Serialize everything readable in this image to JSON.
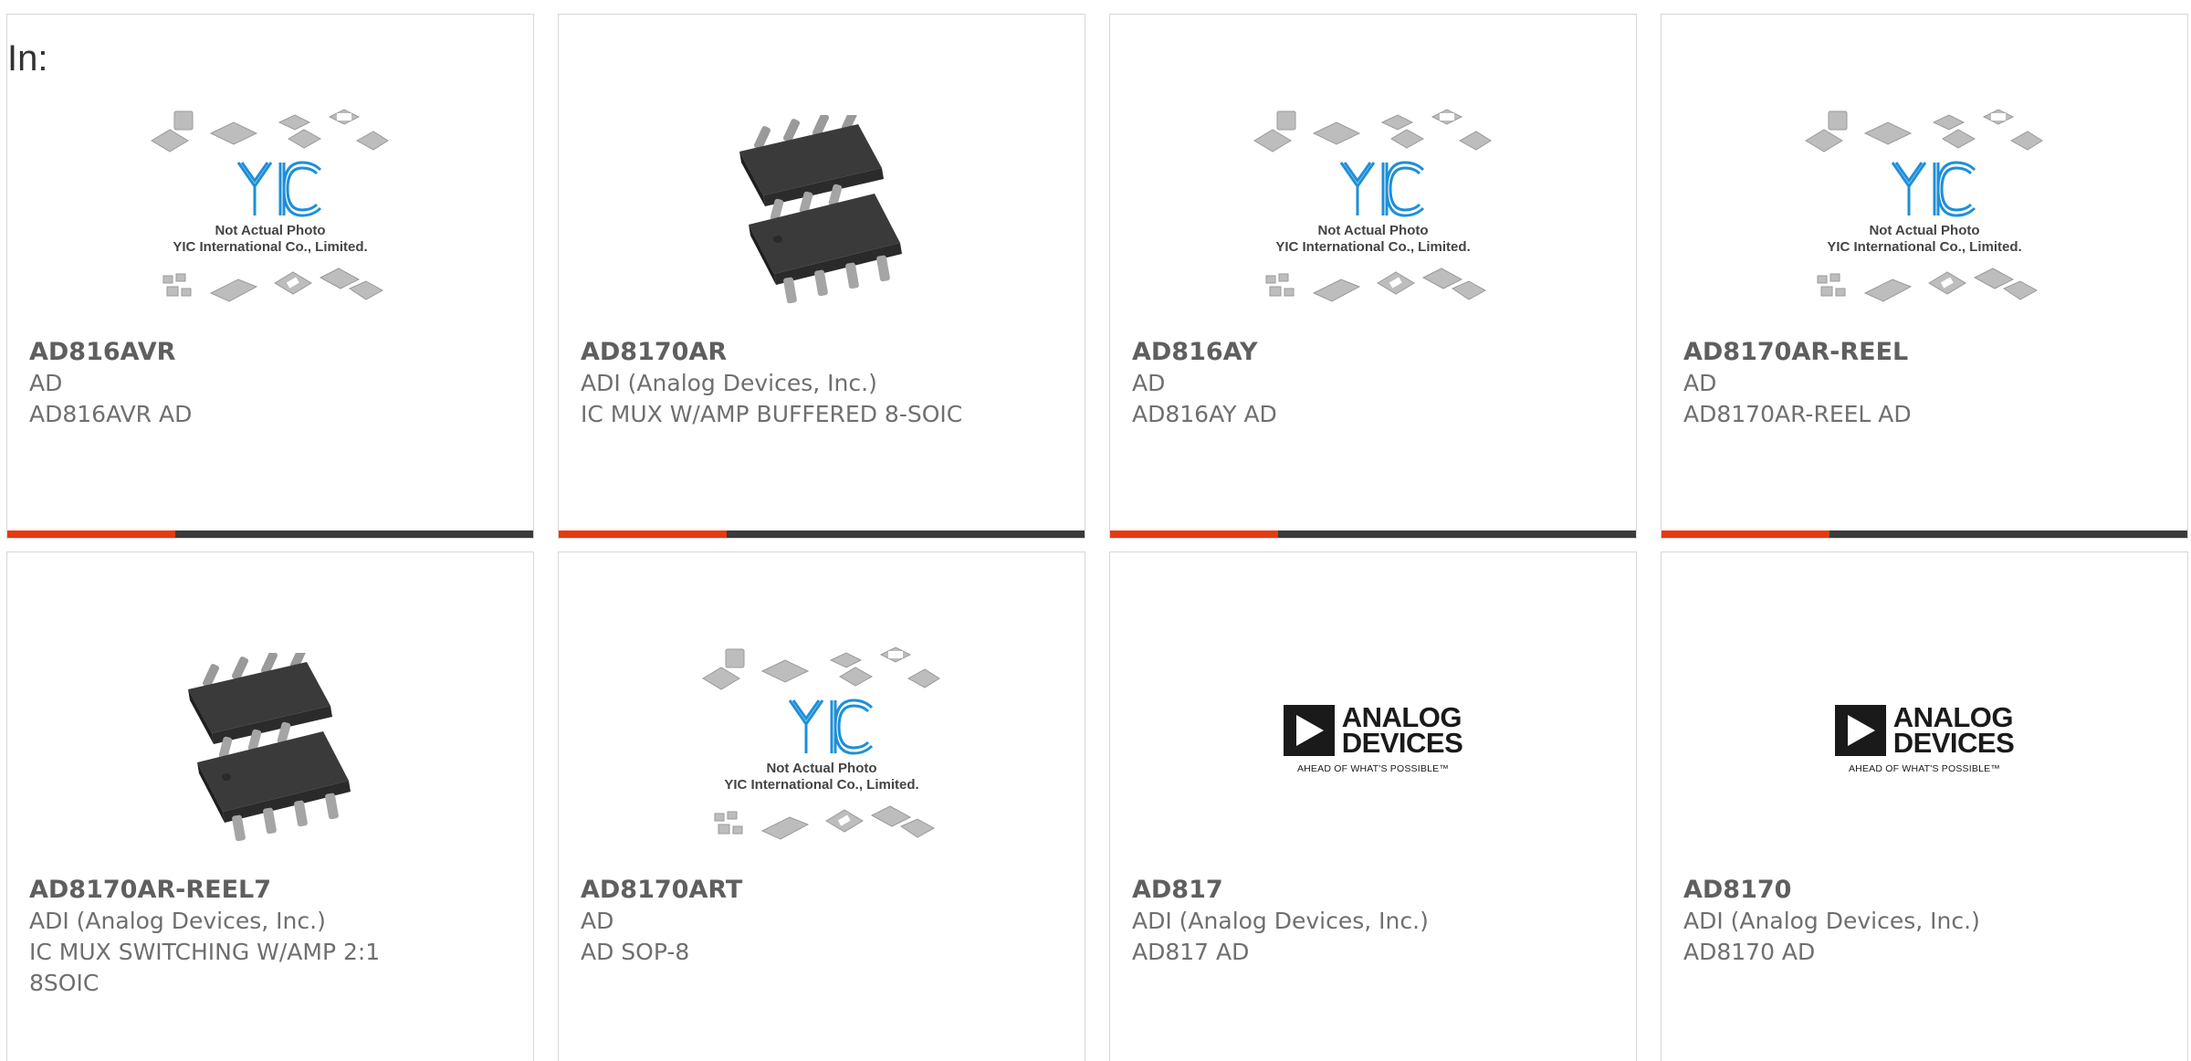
{
  "filter": {
    "label": "In:"
  },
  "colors": {
    "accent": "#e53a10",
    "bar": "#3b3b3b",
    "text": "#6f6f6f"
  },
  "placeholder": {
    "line1": "Not Actual Photo",
    "line2": "YIC International Co., Limited."
  },
  "adi": {
    "line1": "ANALOG",
    "line2": "DEVICES",
    "tagline": "AHEAD OF WHAT'S POSSIBLE™"
  },
  "products": [
    {
      "part": "AD816AVR",
      "mfr": "AD",
      "desc": "AD816AVR AD",
      "image": "yic-placeholder",
      "selected": true
    },
    {
      "part": "AD8170AR",
      "mfr": "ADI (Analog Devices, Inc.)",
      "desc": "IC MUX W/AMP BUFFERED 8-SOIC",
      "image": "soic-chip",
      "selected": true
    },
    {
      "part": "AD816AY",
      "mfr": "AD",
      "desc": "AD816AY AD",
      "image": "yic-placeholder",
      "selected": true
    },
    {
      "part": "AD8170AR-REEL",
      "mfr": "AD",
      "desc": "AD8170AR-REEL AD",
      "image": "yic-placeholder",
      "selected": true
    },
    {
      "part": "AD8170AR-REEL7",
      "mfr": "ADI (Analog Devices, Inc.)",
      "desc": "IC MUX SWITCHING W/AMP 2:1 8SOIC",
      "image": "soic-chip",
      "selected": false
    },
    {
      "part": "AD8170ART",
      "mfr": "AD",
      "desc": "AD SOP-8",
      "image": "yic-placeholder",
      "selected": false
    },
    {
      "part": "AD817",
      "mfr": "ADI (Analog Devices, Inc.)",
      "desc": "AD817 AD",
      "image": "adi-logo",
      "selected": false
    },
    {
      "part": "AD8170",
      "mfr": "ADI (Analog Devices, Inc.)",
      "desc": "AD8170 AD",
      "image": "adi-logo",
      "selected": false
    }
  ]
}
